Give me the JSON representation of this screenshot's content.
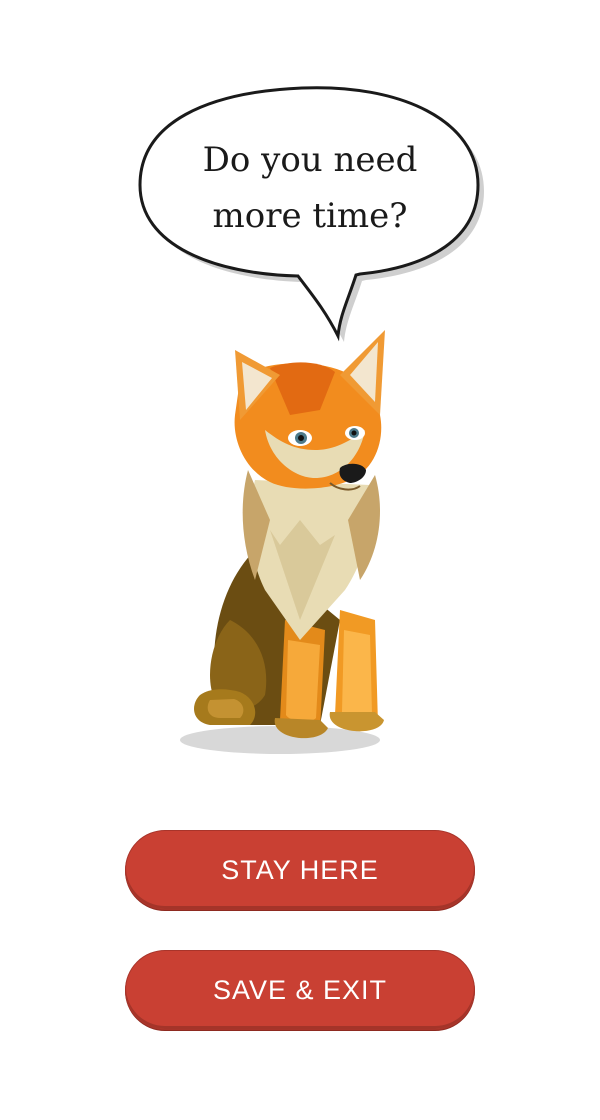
{
  "dialog": {
    "question_line1": "Do you need",
    "question_line2": "more time?"
  },
  "buttons": {
    "stay_label": "STAY HERE",
    "exit_label": "SAVE & EXIT"
  },
  "colors": {
    "button_bg": "#c94033",
    "bubble_border": "#1a1a1a",
    "fox_orange": "#f28c1e",
    "fox_cream": "#e8dcb4"
  },
  "icons": {
    "mascot": "fox-mascot-icon",
    "speech": "speech-bubble-icon"
  }
}
